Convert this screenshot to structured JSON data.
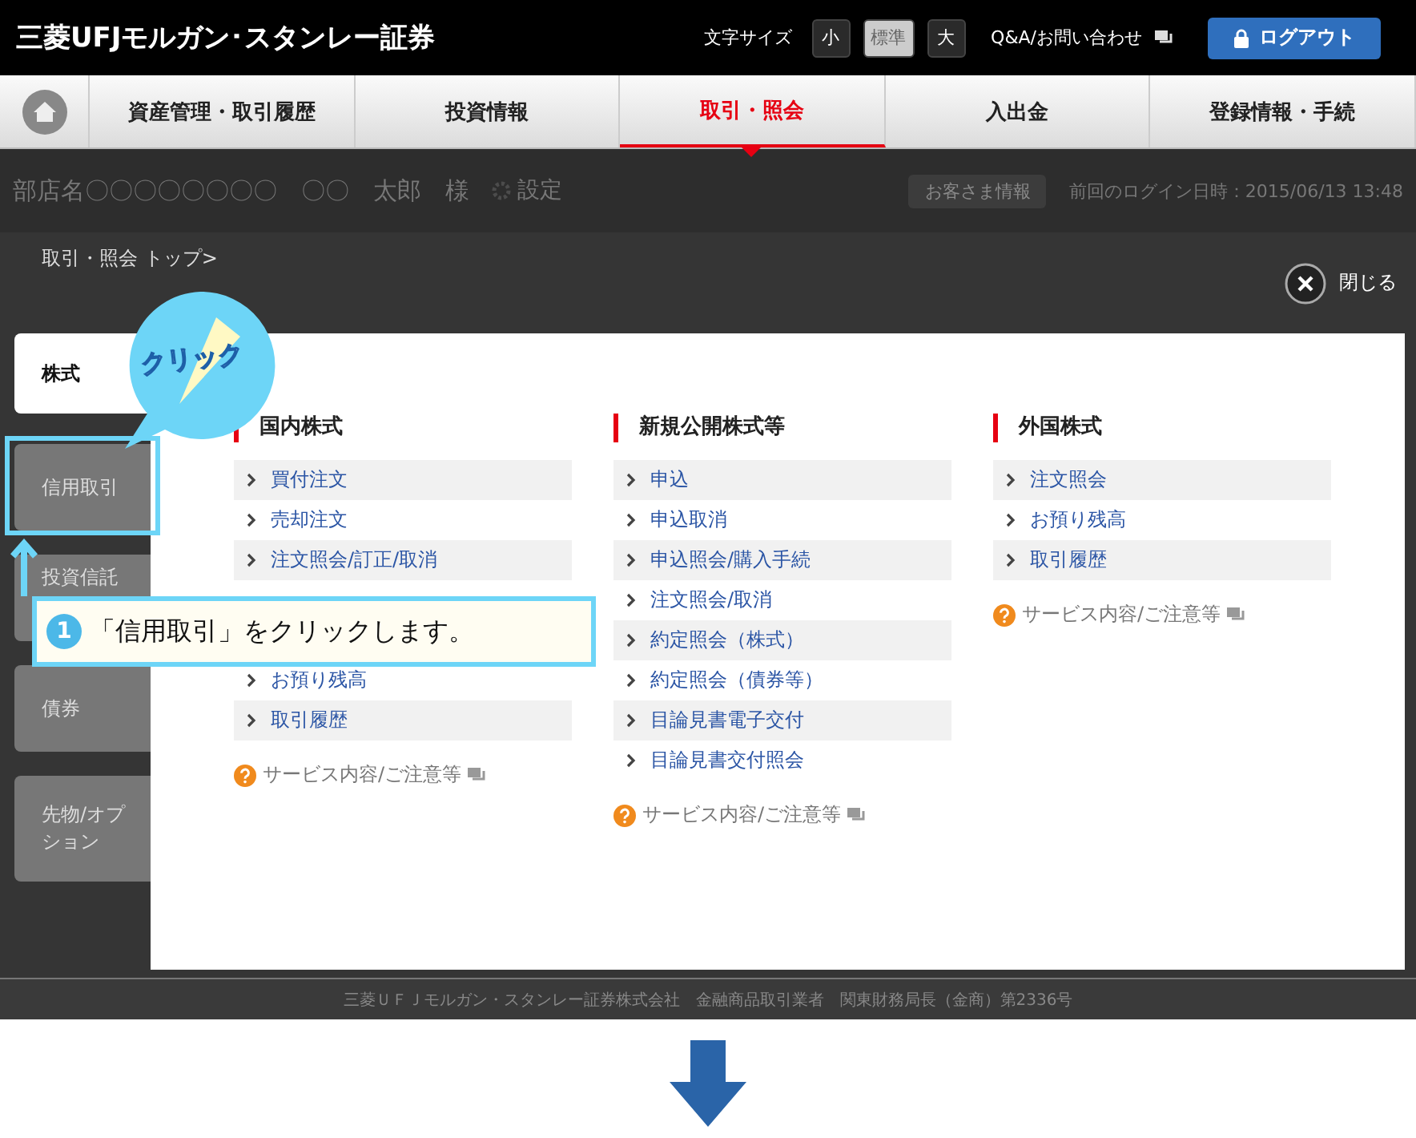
{
  "header": {
    "logo": "三菱UFJモルガン･スタンレー証券",
    "font_size_label": "文字サイズ",
    "font_sizes": [
      {
        "label": "小",
        "selected": false
      },
      {
        "label": "標準",
        "selected": true
      },
      {
        "label": "大",
        "selected": false
      }
    ],
    "help_link": "Q&A/お問い合わせ",
    "logout_button": "ログアウト"
  },
  "nav": {
    "items": [
      {
        "label": "資産管理・取引履歴",
        "selected": false
      },
      {
        "label": "投資情報",
        "selected": false
      },
      {
        "label": "取引・照会",
        "selected": true
      },
      {
        "label": "入出金",
        "selected": false
      },
      {
        "label": "登録情報・手続",
        "selected": false
      }
    ]
  },
  "user_bar": {
    "name": "部店名〇〇〇〇〇〇〇〇　〇〇　太郎　様",
    "settings": "設定",
    "customer_info": "お客さま情報",
    "last_login": "前回のログイン日時：2015/06/13 13:48"
  },
  "menu": {
    "breadcrumb": "取引・照会 トップ>",
    "close_label": "閉じる",
    "tabs": [
      {
        "label": "株式",
        "selected": true
      },
      {
        "label": "信用取引",
        "selected": false
      },
      {
        "label": "投資信託",
        "selected": false
      },
      {
        "label": "債券",
        "selected": false
      },
      {
        "label": "先物/オプション",
        "selected": false
      }
    ],
    "columns": [
      {
        "title": "国内株式",
        "items": [
          "買付注文",
          "売却注文",
          "注文照会/訂正/取消",
          "お預り残高",
          "取引履歴"
        ],
        "footer_link": "サービス内容/ご注意等"
      },
      {
        "title": "新規公開株式等",
        "items": [
          "申込",
          "申込取消",
          "申込照会/購入手続",
          "注文照会/取消",
          "約定照会（株式）",
          "約定照会（債券等）",
          "目論見書電子交付",
          "目論見書交付照会"
        ],
        "footer_link": "サービス内容/ご注意等"
      },
      {
        "title": "外国株式",
        "items": [
          "注文照会",
          "お預り残高",
          "取引履歴"
        ],
        "footer_link": "サービス内容/ご注意等"
      }
    ]
  },
  "footer": {
    "text": "三菱ＵＦＪモルガン・スタンレー証券株式会社　金融商品取引業者　関東財務局長（金商）第2336号"
  },
  "annotation": {
    "bubble_text": "クリック",
    "step_number": "1",
    "instruction": "「信用取引」をクリックします。"
  }
}
